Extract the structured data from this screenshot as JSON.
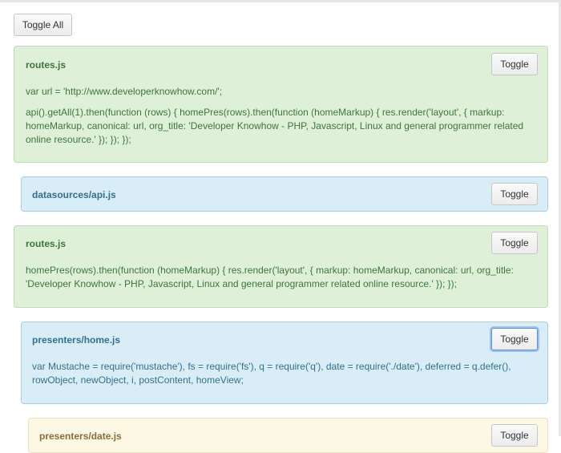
{
  "toggle_all_label": "Toggle All",
  "toggle_label": "Toggle",
  "panels": [
    {
      "title": "routes.js",
      "lines": [
        "var url = 'http://www.developerknowhow.com/';",
        "api().getAll(1).then(function (rows) { homePres(rows).then(function (homeMarkup) { res.render('layout', { markup: homeMarkup, canonical: url, org_title: 'Developer Knowhow - PHP, Javascript, Linux and general programmer related online resource.' }); }); });"
      ]
    },
    {
      "title": "datasources/api.js",
      "lines": []
    },
    {
      "title": "routes.js",
      "lines": [
        "homePres(rows).then(function (homeMarkup) { res.render('layout', { markup: homeMarkup, canonical: url, org_title: 'Developer Knowhow - PHP, Javascript, Linux and general programmer related online resource.' }); });"
      ]
    },
    {
      "title": "presenters/home.js",
      "lines": [
        "var Mustache = require('mustache'), fs = require('fs'), q = require('q'), date = require('./date'), deferred = q.defer(), rowObject, newObject, i, postContent, homeView;"
      ]
    },
    {
      "title": "presenters/date.js",
      "lines": []
    }
  ],
  "colors": {
    "green_bg": "#dff0d8",
    "blue_bg": "#d9edf7",
    "yellow_bg": "#fcf8e3",
    "focus_ring": "#5a8fdc"
  }
}
